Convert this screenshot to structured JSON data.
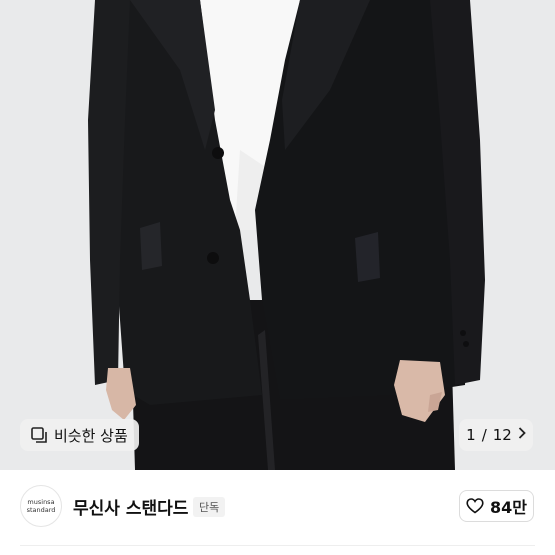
{
  "gallery": {
    "similar_products_label": "비슷한 상품",
    "counter": {
      "current": "1",
      "separator": "/",
      "total": "12"
    }
  },
  "store": {
    "logo_line1": "musinsa",
    "logo_line2": "standard",
    "name": "무신사 스탠다드",
    "badge": "단독",
    "likes": "84만"
  },
  "icons": {
    "similar": "square-stack-icon",
    "next": "chevron-right-icon",
    "like": "heart-outline-icon"
  }
}
